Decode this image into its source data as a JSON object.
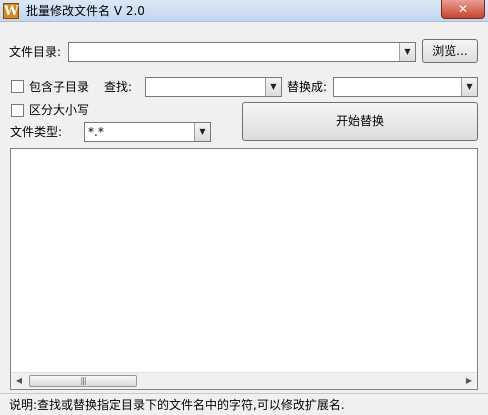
{
  "window": {
    "title": "批量修改文件名 V 2.0",
    "icon_letter": "W",
    "close_glyph": "✕"
  },
  "form": {
    "dir_label": "文件目录:",
    "dir_value": "",
    "browse_label": "浏览...",
    "include_subdirs_label": "包含子目录",
    "include_subdirs_checked": false,
    "find_label": "查找:",
    "find_value": "",
    "replace_label": "替换成:",
    "replace_value": "",
    "case_label": "区分大小写",
    "case_checked": false,
    "filetype_label": "文件类型:",
    "filetype_value": "*.*",
    "start_label": "开始替换"
  },
  "list": {
    "items": [],
    "scroll_left_glyph": "◀",
    "scroll_right_glyph": "▶",
    "thumb_grip": "|||"
  },
  "status": {
    "text": "说明:查找或替换指定目录下的文件名中的字符,可以修改扩展名."
  },
  "icons": {
    "dropdown": "▼"
  }
}
